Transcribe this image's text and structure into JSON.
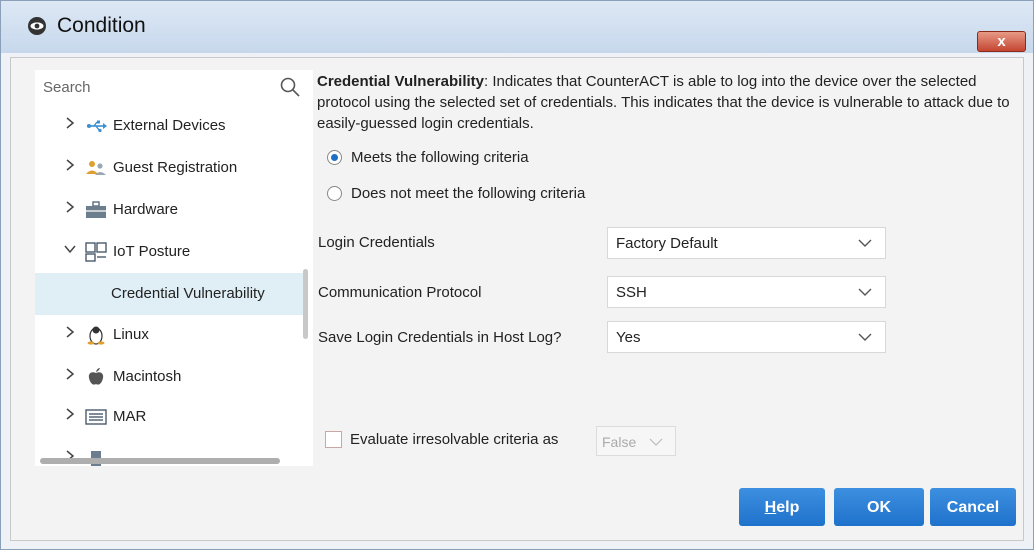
{
  "window": {
    "title": "Condition",
    "close_label": "x"
  },
  "sidebar": {
    "search_placeholder": "Search",
    "items": [
      {
        "label": "External Devices",
        "expanded": false,
        "icon": "usb-icon"
      },
      {
        "label": "Guest Registration",
        "expanded": false,
        "icon": "guests-icon"
      },
      {
        "label": "Hardware",
        "expanded": false,
        "icon": "hardware-icon"
      },
      {
        "label": "IoT Posture",
        "expanded": true,
        "icon": "iot-icon"
      },
      {
        "label": "Credential Vulnerability",
        "selected": true
      },
      {
        "label": "Linux",
        "expanded": false,
        "icon": "linux-icon"
      },
      {
        "label": "Macintosh",
        "expanded": false,
        "icon": "apple-icon"
      },
      {
        "label": "MAR",
        "expanded": false,
        "icon": "mar-icon"
      }
    ]
  },
  "main": {
    "description_title": "Credential Vulnerability",
    "description_body": ": Indicates that CounterACT is able to log into the device over the selected protocol using the selected set of credentials. This indicates that the device is vulnerable to attack due to easily-guessed login credentials.",
    "radios": [
      {
        "label": "Meets the following criteria",
        "checked": true
      },
      {
        "label": "Does not meet the following criteria",
        "checked": false
      }
    ],
    "fields": [
      {
        "label": "Login Credentials",
        "value": "Factory Default"
      },
      {
        "label": "Communication Protocol",
        "value": "SSH"
      },
      {
        "label": "Save Login Credentials in Host Log?",
        "value": "Yes"
      }
    ],
    "evaluate_label": "Evaluate irresolvable criteria as",
    "evaluate_value": "False",
    "evaluate_checked": false
  },
  "buttons": {
    "help": "Help",
    "ok": "OK",
    "cancel": "Cancel"
  },
  "colors": {
    "accent": "#1f72cb",
    "selected_row": "#e0eef6"
  }
}
